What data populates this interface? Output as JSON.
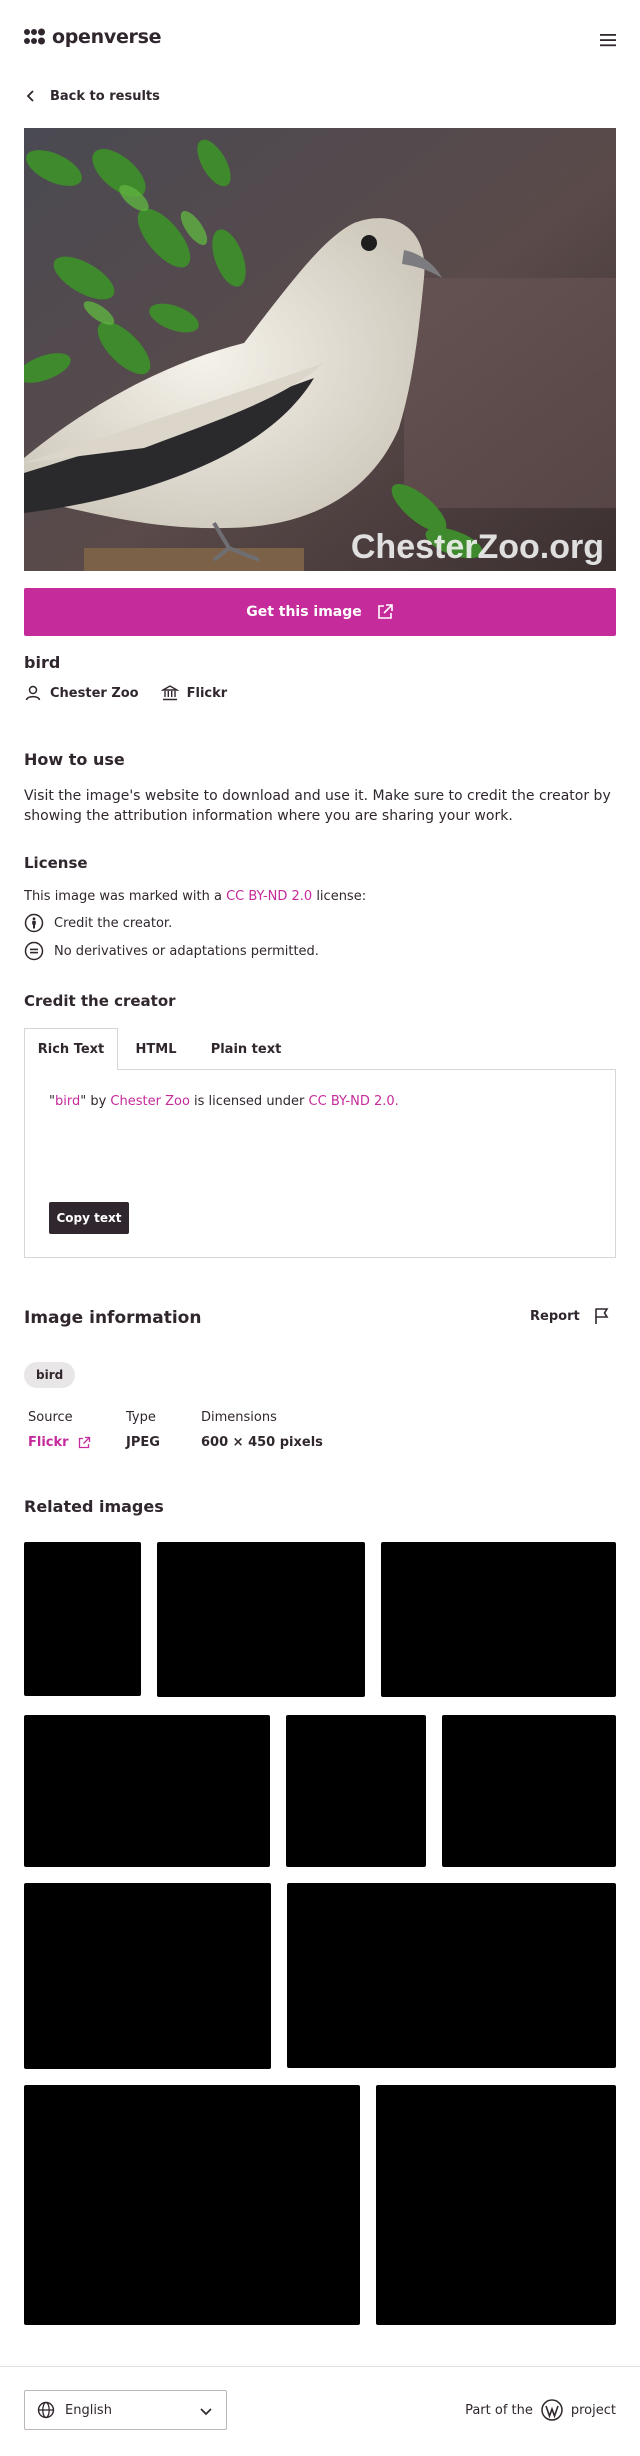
{
  "header": {
    "logo_text": "openverse"
  },
  "nav": {
    "back_label": "Back to results"
  },
  "image": {
    "watermark": "ChesterZoo.org",
    "cta_label": "Get this image"
  },
  "details": {
    "title": "bird",
    "creator": "Chester Zoo",
    "source": "Flickr"
  },
  "how_to_use": {
    "heading": "How to use",
    "text": "Visit the image's website to download and use it. Make sure to credit the creator by showing the attribution information where you are sharing your work."
  },
  "license": {
    "heading": "License",
    "intro_before": "This image was marked with a ",
    "license_name": "CC BY-ND 2.0",
    "intro_after": " license:",
    "items": [
      "Credit the creator.",
      "No derivatives or adaptations permitted."
    ]
  },
  "credit": {
    "heading": "Credit the creator",
    "tabs": [
      "Rich Text",
      "HTML",
      "Plain text"
    ],
    "attr_quote_open": "\"",
    "attr_title": "bird",
    "attr_quote_close": "\"",
    "attr_by": " by ",
    "attr_creator": "Chester Zoo",
    "attr_mid": " is licensed under ",
    "attr_license": "CC BY-ND 2.0",
    "attr_end": ".",
    "copy_label": "Copy text"
  },
  "image_info": {
    "heading": "Image information",
    "report_label": "Report",
    "tag": "bird",
    "source_label": "Source",
    "source_value": "Flickr",
    "type_label": "Type",
    "type_value": "JPEG",
    "dimensions_label": "Dimensions",
    "dimensions_value": "600 × 450 pixels"
  },
  "related": {
    "heading": "Related images"
  },
  "footer": {
    "language": "English",
    "part_of_before": "Part of the",
    "part_of_after": "project"
  },
  "colors": {
    "accent": "#c52b9b",
    "text": "#30272e",
    "placeholder": "#000000"
  }
}
